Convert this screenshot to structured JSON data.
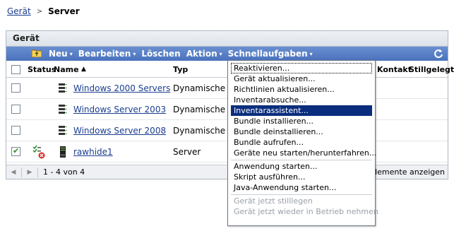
{
  "breadcrumb": {
    "parent": "Gerät",
    "separator": ">",
    "current": "Server"
  },
  "panel": {
    "title": "Gerät"
  },
  "toolbar": {
    "new": "Neu",
    "edit": "Bearbeiten",
    "delete": "Löschen",
    "action": "Aktion",
    "quick_tasks": "Schnellaufgaben",
    "caret": "▾",
    "icons": {
      "folder": "folder-up-icon",
      "refresh": "refresh-icon"
    }
  },
  "table": {
    "headers": {
      "status": "Status",
      "name": "Name",
      "sort_indicator": "▲",
      "type": "Typ",
      "contact": "Kontakt",
      "stilllegt": "Stillgelegt"
    },
    "rows": [
      {
        "checked": false,
        "status_icon": "",
        "type_icon": "group-icon",
        "name": "Windows 2000 Servers",
        "type": "Dynamische S"
      },
      {
        "checked": false,
        "status_icon": "",
        "type_icon": "group-icon",
        "name": "Windows Server 2003",
        "type": "Dynamische S"
      },
      {
        "checked": false,
        "status_icon": "",
        "type_icon": "group-icon",
        "name": "Windows Server 2008",
        "type": "Dynamische S"
      },
      {
        "checked": true,
        "status_icon": "status-error-icon",
        "type_icon": "server-icon",
        "name": "rawhide1",
        "type": "Server"
      }
    ]
  },
  "pager": {
    "prev": "◀",
    "next": "▶",
    "info": "1 - 4 von 4",
    "show_items": "Elemente anzeigen"
  },
  "menu": {
    "items": [
      {
        "label": "Reaktivieren...",
        "state": "focus"
      },
      {
        "label": "Gerät aktualisieren...",
        "state": "normal"
      },
      {
        "label": "Richtlinien aktualisieren...",
        "state": "normal"
      },
      {
        "label": "Inventarabsuche...",
        "state": "normal"
      },
      {
        "label": "Inventarassistent...",
        "state": "active"
      },
      {
        "label": "Bundle installieren...",
        "state": "normal"
      },
      {
        "label": "Bundle deinstallieren...",
        "state": "normal"
      },
      {
        "label": "Bundle aufrufen...",
        "state": "normal"
      },
      {
        "label": "Geräte neu starten/herunterfahren...",
        "state": "normal"
      },
      {
        "label": "Anwendung starten...",
        "state": "normal"
      },
      {
        "label": "Skript ausführen...",
        "state": "normal"
      },
      {
        "label": "Java-Anwendung starten...",
        "state": "normal"
      },
      {
        "label": "Gerät jetzt stilllegen",
        "state": "disabled"
      },
      {
        "label": "Gerät jetzt wieder in Betrieb nehmen",
        "state": "disabled"
      }
    ]
  },
  "colors": {
    "toolbar": "#4a72bd",
    "link": "#1a3d8f",
    "menu_active": "#0a2e7d"
  }
}
